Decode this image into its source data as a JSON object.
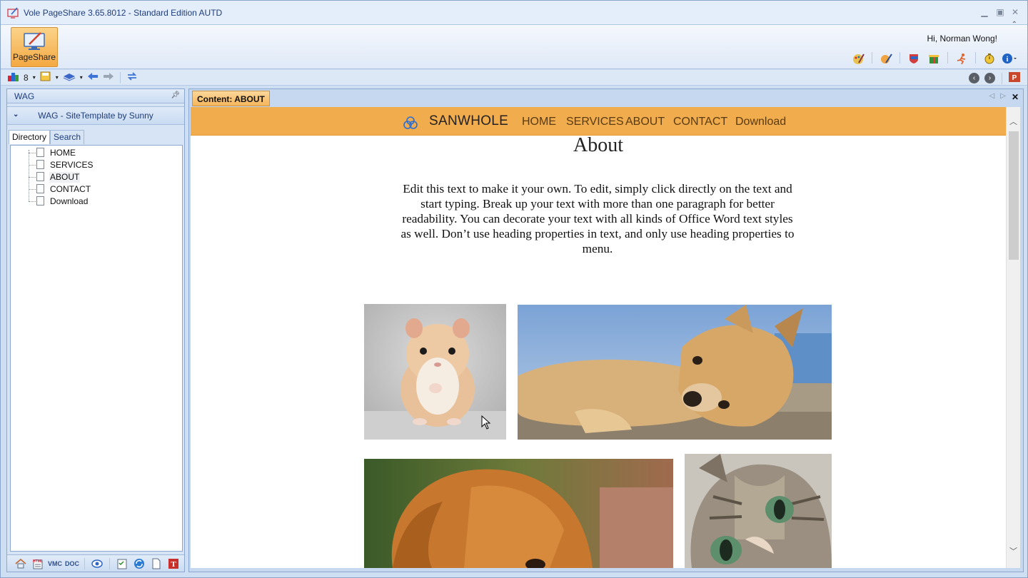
{
  "window": {
    "title": "Vole PageShare  3.65.8012 - Standard Edition AUTD"
  },
  "ribbon": {
    "pageshare_label": "PageShare",
    "greeting": "Hi, Norman Wong!"
  },
  "toolbar": {
    "count_label": "8"
  },
  "left_pane": {
    "header": "WAG",
    "site_title": "WAG - SiteTemplate by Sunny",
    "tabs": [
      "Directory",
      "Search"
    ],
    "tree": [
      "HOME",
      "SERVICES",
      "ABOUT",
      "CONTACT",
      "Download"
    ],
    "selected": "ABOUT",
    "bottom_tools": [
      "home-icon",
      "html-icon",
      "vmc-icon",
      "doc-icon",
      "preview-eye-icon",
      "checklist-icon",
      "refresh-icon",
      "new-page-icon",
      "text-tool-icon"
    ]
  },
  "document": {
    "tab_label": "Content: ABOUT",
    "site": {
      "brand": "SANWHOLE",
      "nav": [
        "HOME",
        "SERVICES",
        "ABOUT",
        "CONTACT",
        "Download"
      ],
      "nav_color": "#f0ac4d",
      "page_title": "About",
      "body_text": "Edit this text to make it your own. To edit, simply click directly on the text and start typing. Break up your text with more than one paragraph for better readability. You can decorate your text with all kinds of Office Word text styles as well. Don’t use heading properties in text, and only use heading properties to menu.",
      "photos": [
        "hamster-photo",
        "puppy-lying-photo",
        "golden-dog-photo",
        "kitten-photo"
      ]
    }
  }
}
